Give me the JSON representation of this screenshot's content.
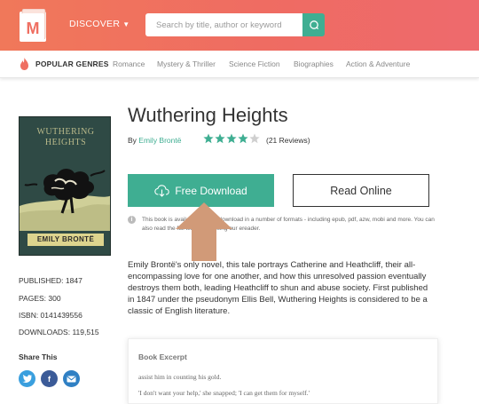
{
  "header": {
    "discover_label": "DISCOVER",
    "search_placeholder": "Search by title, author or keyword"
  },
  "genres": {
    "popular_label": "POPULAR GENRES",
    "items": [
      "Romance",
      "Mystery & Thriller",
      "Science Fiction",
      "Biographies",
      "Action & Adventure"
    ]
  },
  "cover": {
    "title_line1": "WUTHERING",
    "title_line2": "HEIGHTS",
    "author": "EMILY BRONTË"
  },
  "book": {
    "title": "Wuthering Heights",
    "by_label": "By",
    "author": "Emily Brontë",
    "rating": 4,
    "rating_max": 5,
    "reviews": "(21 Reviews)"
  },
  "actions": {
    "download_label": "Free Download",
    "read_label": "Read Online"
  },
  "info_text": "This book is available for free download in a number of formats - including epub, pdf, azw, mobi and more. You can also read the full text online using our ereader.",
  "description": "Emily Brontë's only novel, this tale portrays Catherine and Heathcliff, their all-encompassing love for one another, and how this unresolved passion eventually destroys them both, leading Heathcliff to shun and abuse society. First published in 1847 under the pseudonym Ellis Bell, Wuthering Heights is considered to be a classic of English literature.",
  "meta": {
    "published": "PUBLISHED: 1847",
    "pages": "PAGES: 300",
    "isbn": "ISBN: 0141439556",
    "downloads": "DOWNLOADS: 119,515"
  },
  "share": {
    "title": "Share This",
    "twitter_color": "#3a9fde",
    "facebook_color": "#3b5b98",
    "email_color": "#2f80c4"
  },
  "excerpt": {
    "title": "Book Excerpt",
    "line1": "assist him in counting his gold.",
    "line2": "'I don't want your help,' she snapped; 'I can get them for myself.'"
  },
  "colors": {
    "brand_coral": "#ef6f62",
    "accent_green": "#3fae92",
    "arrow_tan": "#d19a78"
  }
}
